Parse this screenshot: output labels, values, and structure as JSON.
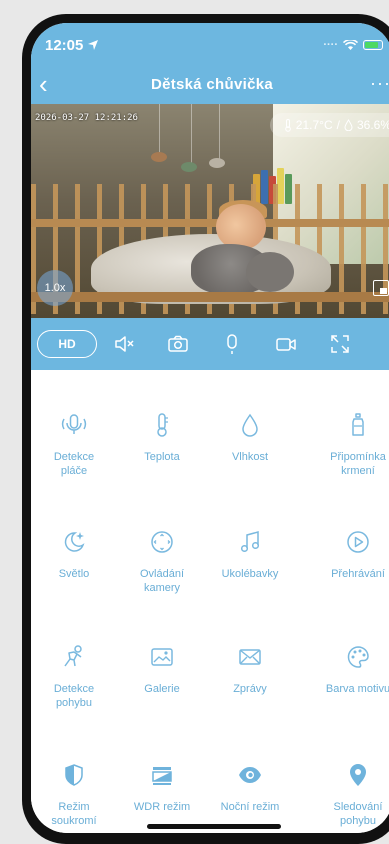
{
  "status_bar": {
    "time": "12:05",
    "signal": "····"
  },
  "header": {
    "title": "Dětská chůvička",
    "back": "‹",
    "more": "···"
  },
  "video": {
    "timestamp": "2026-03-27 12:21:26",
    "temperature": "21.7°C",
    "separator": "/",
    "humidity": "36.6%",
    "zoom": "1.0x"
  },
  "controls": {
    "hd_label": "HD"
  },
  "features": [
    {
      "label": "Detekce\npláče",
      "icon": "cry-detection-icon"
    },
    {
      "label": "Teplota",
      "icon": "thermometer-icon"
    },
    {
      "label": "Vlhkost",
      "icon": "humidity-icon"
    },
    {
      "label": "Připomínka\nkrmení",
      "icon": "bottle-icon"
    },
    {
      "label": "Světlo",
      "icon": "night-light-icon"
    },
    {
      "label": "Ovládání\nkamery",
      "icon": "camera-control-icon"
    },
    {
      "label": "Ukolébavky",
      "icon": "music-icon"
    },
    {
      "label": "Přehrávání",
      "icon": "play-icon"
    },
    {
      "label": "Detekce\npohybu",
      "icon": "motion-icon"
    },
    {
      "label": "Galerie",
      "icon": "gallery-icon"
    },
    {
      "label": "Zprávy",
      "icon": "envelope-icon"
    },
    {
      "label": "Barva motivu",
      "icon": "palette-icon"
    },
    {
      "label": "Režim\nsoukromí",
      "icon": "privacy-shield-icon"
    },
    {
      "label": "WDR režim",
      "icon": "wdr-icon"
    },
    {
      "label": "Noční režim",
      "icon": "eye-icon"
    },
    {
      "label": "Sledování\npohybu",
      "icon": "location-pin-icon"
    }
  ],
  "colors": {
    "accent": "#6db7e0",
    "label": "#6aaed6",
    "icon": "#7ab9df"
  }
}
